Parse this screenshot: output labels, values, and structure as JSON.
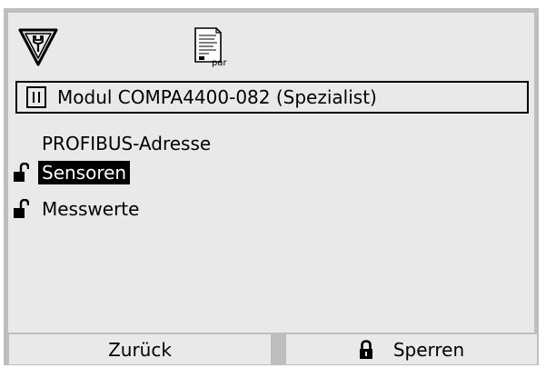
{
  "header": {
    "icons": [
      "wrench-icon",
      "parameter-file-icon"
    ],
    "param_icon_label": "par"
  },
  "module_bar": {
    "title": "Modul COMPA4400-082 (Spezialist)"
  },
  "menu": {
    "items": [
      {
        "label": "PROFIBUS-Adresse",
        "locked_icon": false,
        "selected": false
      },
      {
        "label": "Sensoren",
        "locked_icon": true,
        "selected": true
      },
      {
        "label": "Messwerte",
        "locked_icon": true,
        "selected": false
      }
    ]
  },
  "footer": {
    "left_label": "Zurück",
    "right_label": "Sperren"
  },
  "colors": {
    "frame": "#bebebe",
    "panel": "#e9e9e9",
    "text": "#000000",
    "selection_bg": "#000000",
    "selection_text": "#ffffff"
  }
}
